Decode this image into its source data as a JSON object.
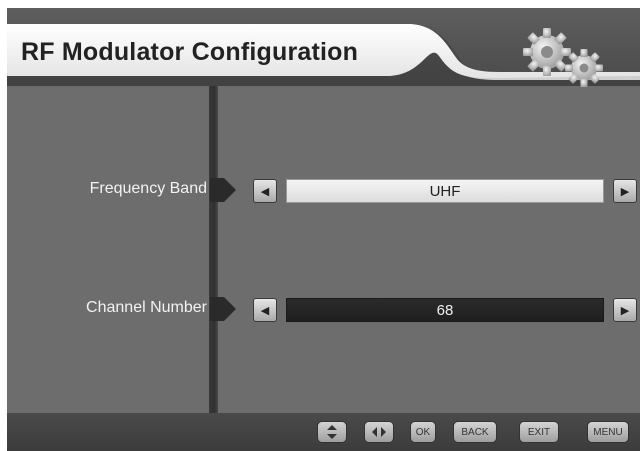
{
  "title": "RF Modulator Configuration",
  "settings": [
    {
      "label": "Frequency Band",
      "value": "UHF",
      "selected": true
    },
    {
      "label": "Channel Number",
      "value": "68",
      "selected": false
    }
  ],
  "footer_keys": {
    "updown_icon": "up-down-arrows-icon",
    "leftright_icon": "left-right-arrows-icon",
    "ok": "OK",
    "back": "BACK",
    "exit": "EXIT",
    "menu": "MENU"
  },
  "colors": {
    "background": "#6d6d6d",
    "header_panel": "#ffffff",
    "selected_value_bg": "#ebebeb",
    "unselected_value_bg": "#252525"
  }
}
